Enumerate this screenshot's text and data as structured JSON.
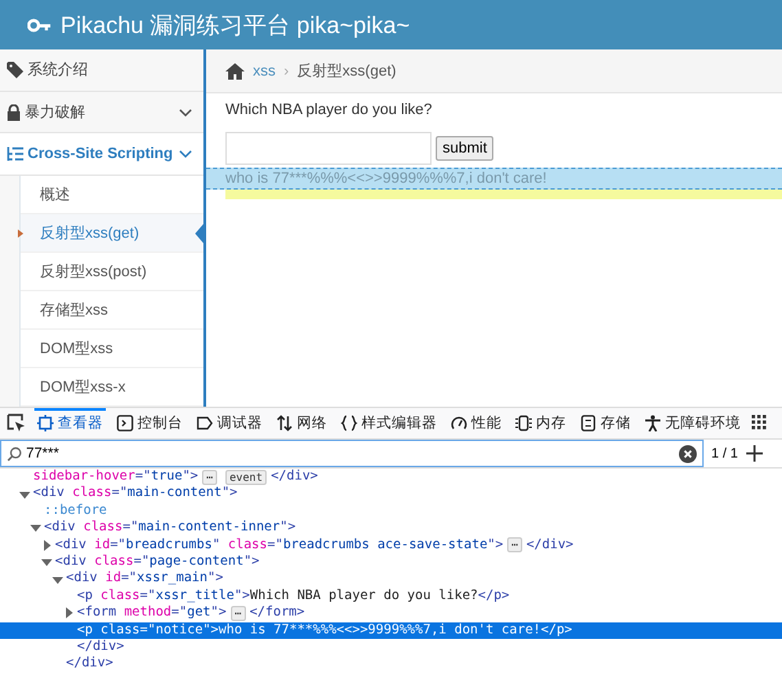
{
  "header": {
    "title": "Pikachu 漏洞练习平台 pika~pika~"
  },
  "sidebar": {
    "items": [
      {
        "label": "系统介绍",
        "kind": "tag"
      },
      {
        "label": "暴力破解",
        "kind": "lock",
        "expanded": false
      },
      {
        "label": "Cross-Site Scripting",
        "kind": "list",
        "expanded": true,
        "children": [
          {
            "label": "概述",
            "selected": false
          },
          {
            "label": "反射型xss(get)",
            "selected": true
          },
          {
            "label": "反射型xss(post)",
            "selected": false
          },
          {
            "label": "存储型xss",
            "selected": false
          },
          {
            "label": "DOM型xss",
            "selected": false
          },
          {
            "label": "DOM型xss-x",
            "selected": false
          }
        ]
      }
    ]
  },
  "breadcrumbs": {
    "separator": "›",
    "items": [
      "xss",
      "反射型xss(get)"
    ]
  },
  "page": {
    "question": "Which NBA player do you like?",
    "submit": "submit",
    "notice": "who is 77***%%%<<>>9999%%%7,i don't care!",
    "notice_highlighted": true
  },
  "devtools": {
    "tabs": [
      {
        "label": "查看器",
        "kind": "inspector",
        "selected": true
      },
      {
        "label": "控制台",
        "kind": "console",
        "selected": false
      },
      {
        "label": "调试器",
        "kind": "debugger",
        "selected": false
      },
      {
        "label": "网络",
        "kind": "network",
        "selected": false
      },
      {
        "label": "样式编辑器",
        "kind": "style",
        "selected": false
      },
      {
        "label": "性能",
        "kind": "performance",
        "selected": false
      },
      {
        "label": "内存",
        "kind": "memory",
        "selected": false
      },
      {
        "label": "存储",
        "kind": "storage",
        "selected": false
      },
      {
        "label": "无障碍环境",
        "kind": "accessibility",
        "selected": false
      }
    ],
    "search": {
      "value": "77***",
      "count": "1 / 1"
    },
    "tree": [
      {
        "selected": false,
        "tokens": [
          {
            "kind": "attr",
            "t": "sidebar-hover"
          },
          {
            "kind": "punct",
            "t": "=\""
          },
          {
            "kind": "val",
            "t": "true"
          },
          {
            "kind": "punct",
            "t": "\">"
          }
        ],
        "badges": [
          "⋯",
          "event"
        ],
        "closing": [
          {
            "kind": "tag",
            "t": "</div>"
          }
        ]
      },
      {
        "selected": false,
        "expanded": true,
        "tokens": [
          {
            "kind": "tag",
            "t": "<div "
          },
          {
            "kind": "attr",
            "t": "class"
          },
          {
            "kind": "punct",
            "t": "=\""
          },
          {
            "kind": "val",
            "t": "main-content"
          },
          {
            "kind": "punct",
            "t": "\">"
          }
        ],
        "children": [
          {
            "selected": false,
            "tokens": [
              {
                "kind": "pseudo",
                "t": "::before"
              }
            ]
          },
          {
            "selected": false,
            "expanded": true,
            "tokens": [
              {
                "kind": "tag",
                "t": "<div "
              },
              {
                "kind": "attr",
                "t": "class"
              },
              {
                "kind": "punct",
                "t": "=\""
              },
              {
                "kind": "val",
                "t": "main-content-inner"
              },
              {
                "kind": "punct",
                "t": "\">"
              }
            ],
            "children": [
              {
                "selected": false,
                "expanded": false,
                "tokens": [
                  {
                    "kind": "tag",
                    "t": "<div "
                  },
                  {
                    "kind": "attr",
                    "t": "id"
                  },
                  {
                    "kind": "punct",
                    "t": "=\""
                  },
                  {
                    "kind": "val",
                    "t": "breadcrumbs"
                  },
                  {
                    "kind": "punct",
                    "t": "\" "
                  },
                  {
                    "kind": "attr",
                    "t": "class"
                  },
                  {
                    "kind": "punct",
                    "t": "=\""
                  },
                  {
                    "kind": "val",
                    "t": "breadcrumbs ace-save-state"
                  },
                  {
                    "kind": "punct",
                    "t": "\">"
                  }
                ],
                "badges": [
                  "⋯"
                ],
                "closing": [
                  {
                    "kind": "tag",
                    "t": "</div>"
                  }
                ]
              },
              {
                "selected": false,
                "expanded": true,
                "tokens": [
                  {
                    "kind": "tag",
                    "t": "<div "
                  },
                  {
                    "kind": "attr",
                    "t": "class"
                  },
                  {
                    "kind": "punct",
                    "t": "=\""
                  },
                  {
                    "kind": "val",
                    "t": "page-content"
                  },
                  {
                    "kind": "punct",
                    "t": "\">"
                  }
                ],
                "children": [
                  {
                    "selected": false,
                    "expanded": true,
                    "tokens": [
                      {
                        "kind": "tag",
                        "t": "<div "
                      },
                      {
                        "kind": "attr",
                        "t": "id"
                      },
                      {
                        "kind": "punct",
                        "t": "=\""
                      },
                      {
                        "kind": "val",
                        "t": "xssr_main"
                      },
                      {
                        "kind": "punct",
                        "t": "\">"
                      }
                    ],
                    "children": [
                      {
                        "selected": false,
                        "tokens": [
                          {
                            "kind": "tag",
                            "t": "<p "
                          },
                          {
                            "kind": "attr",
                            "t": "class"
                          },
                          {
                            "kind": "punct",
                            "t": "=\""
                          },
                          {
                            "kind": "val",
                            "t": "xssr_title"
                          },
                          {
                            "kind": "punct",
                            "t": "\">"
                          },
                          {
                            "kind": "text",
                            "t": "Which NBA player do you like?"
                          },
                          {
                            "kind": "tag",
                            "t": "</p>"
                          }
                        ]
                      },
                      {
                        "selected": false,
                        "expanded": false,
                        "tokens": [
                          {
                            "kind": "tag",
                            "t": "<form "
                          },
                          {
                            "kind": "attr",
                            "t": "method"
                          },
                          {
                            "kind": "punct",
                            "t": "=\""
                          },
                          {
                            "kind": "val",
                            "t": "get"
                          },
                          {
                            "kind": "punct",
                            "t": "\">"
                          }
                        ],
                        "badges": [
                          "⋯"
                        ],
                        "closing": [
                          {
                            "kind": "tag",
                            "t": "</form>"
                          }
                        ]
                      },
                      {
                        "selected": true,
                        "tokens": [
                          {
                            "kind": "tag",
                            "t": "<p "
                          },
                          {
                            "kind": "attr",
                            "t": "class"
                          },
                          {
                            "kind": "punct",
                            "t": "=\""
                          },
                          {
                            "kind": "val",
                            "t": "notice"
                          },
                          {
                            "kind": "punct",
                            "t": "\">"
                          },
                          {
                            "kind": "text",
                            "t": "who is 77***%%%<<>>9999%%%7,i don't care!"
                          },
                          {
                            "kind": "tag",
                            "t": "</p>"
                          }
                        ]
                      },
                      {
                        "selected": false,
                        "tokens": [
                          {
                            "kind": "tag",
                            "t": "</div>"
                          }
                        ]
                      }
                    ]
                  },
                  {
                    "selected": false,
                    "tokens": [
                      {
                        "kind": "tag",
                        "t": "</div>"
                      }
                    ]
                  }
                ]
              }
            ]
          }
        ]
      }
    ]
  }
}
